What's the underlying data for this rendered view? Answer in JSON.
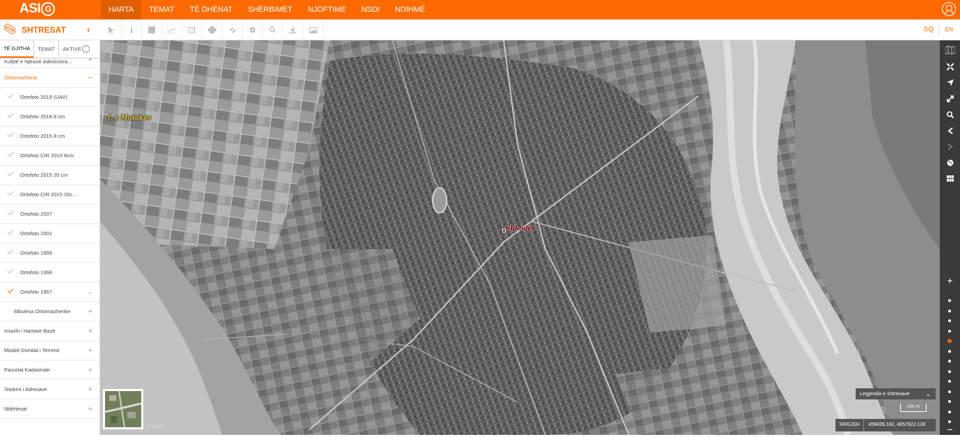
{
  "brand": {
    "logo_text": "ASI",
    "logo_circle": "G"
  },
  "nav": {
    "items": [
      "HARTA",
      "TEMAT",
      "TË DHËNAT",
      "SHËRBIMET",
      "NJOFTIME",
      "NSDI",
      "NDIHMË"
    ],
    "active": "HARTA"
  },
  "header": {
    "user_icon": "user-circle-icon"
  },
  "toolbar": {
    "layers_title": "SHTRESAT",
    "collapse_symbol": "‹",
    "tools": [
      "pointer-icon",
      "info-icon",
      "plus-box-icon",
      "chart-icon",
      "edit-icon",
      "print-icon",
      "link-icon",
      "settings-icon",
      "search-icon",
      "download-icon",
      "image-icon"
    ],
    "lang_sq": "SQ",
    "lang_en": "EN"
  },
  "sidebar": {
    "tabs": [
      "TË GJITHA",
      "TEMAT",
      "AKTIVE"
    ],
    "active_tab": "TË GJITHA",
    "first_group": "Kufijtë e Njësive Administra...",
    "open_group": "Ortoimazheria",
    "ortho_layers": [
      {
        "label": "Ortofoto 2019 (UAV)",
        "checked": false
      },
      {
        "label": "Ortofoto 2018 8 cm",
        "checked": false
      },
      {
        "label": "Ortofoto 2015 8 cm",
        "checked": false
      },
      {
        "label": "Ortofoto CIR 2015 8cm",
        "checked": false
      },
      {
        "label": "Ortofoto 2015 20 cm",
        "checked": false
      },
      {
        "label": "Ortofoto CIR 2015 20c...",
        "checked": false
      },
      {
        "label": "Ortofoto 2007",
        "checked": false
      },
      {
        "label": "Ortofoto 2001",
        "checked": false
      },
      {
        "label": "Ortofoto 1999",
        "checked": false
      },
      {
        "label": "Ortofoto 1994",
        "checked": false
      },
      {
        "label": "Ortofoto 1957",
        "checked": true
      }
    ],
    "mbulesa": "Mbulesa Ortoimazherike",
    "groups": [
      "Imazhi i Hartave Bazë",
      "Modeli Dixhital i Terrenit",
      "Parcelat Kadastrale",
      "Sistemi i Adresave",
      "Ndërtesat"
    ]
  },
  "map": {
    "labels": {
      "marakes": "f. e Marakes",
      "shkoder": "Shkodër"
    },
    "copyright": "© ASIG",
    "legend_button": "Legjenda e shtresave",
    "scale_text": "200 m",
    "crs": "KRGJSH",
    "coordinates": "459428.182, 4657922.128"
  },
  "rightbar": {
    "icons": [
      "map-grid-icon",
      "fullscreen-icon",
      "locate-arrow-icon",
      "expand-icon",
      "zoom-box-icon",
      "back-arrow-icon",
      "forward-arrow-icon",
      "globe-icon",
      "grid-icon"
    ],
    "zoom_in": "+",
    "zoom_out": "−",
    "zoom_levels": 13,
    "zoom_active_index": 4
  }
}
